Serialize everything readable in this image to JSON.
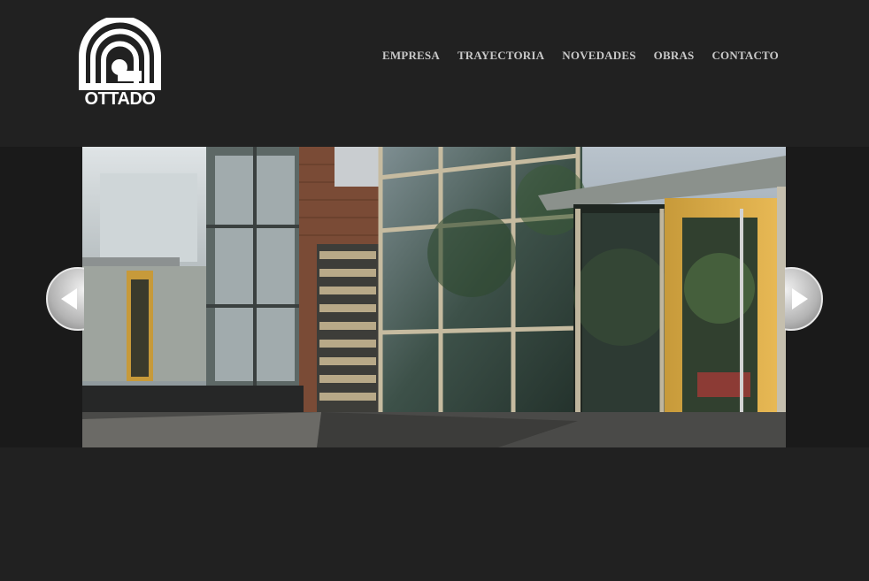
{
  "brand": {
    "name": "OTTADO"
  },
  "nav": {
    "items": [
      {
        "label": "EMPRESA"
      },
      {
        "label": "TRAYECTORIA"
      },
      {
        "label": "NOVEDADES"
      },
      {
        "label": "OBRAS"
      },
      {
        "label": "CONTACTO"
      }
    ]
  },
  "slider": {
    "prev_icon": "chevron-left-icon",
    "next_icon": "chevron-right-icon"
  },
  "colors": {
    "background": "#212121",
    "band": "#1a1a1a",
    "nav_text": "#c9c9c9"
  }
}
